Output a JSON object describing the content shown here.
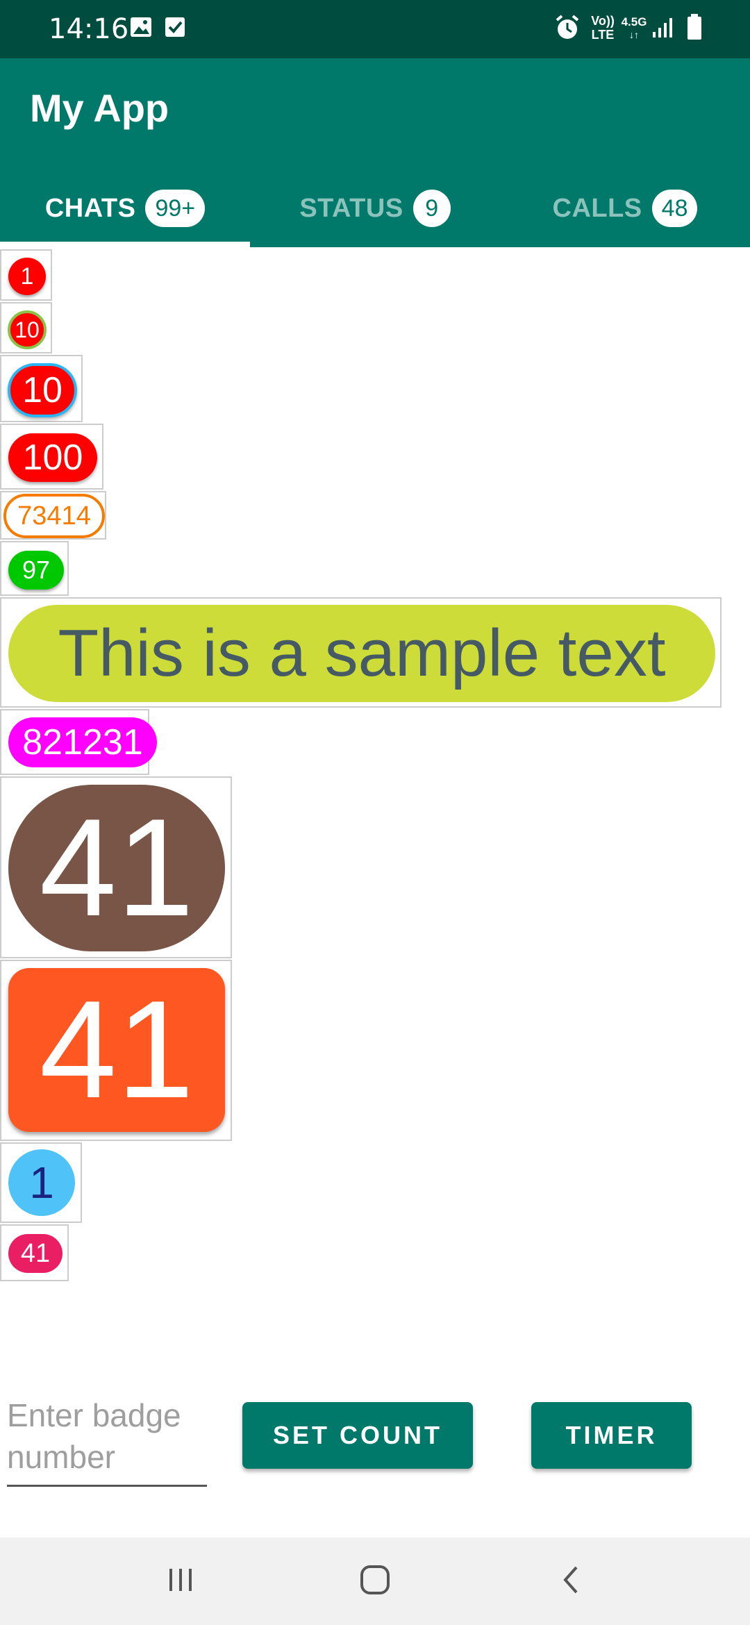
{
  "status_bar": {
    "time": "14:16",
    "icons_left": [
      "image-icon",
      "checkbox-icon"
    ],
    "icons_right": [
      "alarm-icon",
      "volte-icon",
      "network-4.5g-icon",
      "signal-icon",
      "battery-icon"
    ],
    "volte_label_top": "Vo))",
    "volte_label_bottom": "LTE",
    "network_label": "4.5G"
  },
  "app_bar": {
    "title": "My App",
    "background": "#00796b",
    "status_background": "#004d40"
  },
  "tabs": [
    {
      "label": "CHATS",
      "badge": "99+",
      "active": true
    },
    {
      "label": "STATUS",
      "badge": "9",
      "active": false
    },
    {
      "label": "CALLS",
      "badge": "48",
      "active": false
    }
  ],
  "badges": [
    {
      "text": "1",
      "background": "#ff0000",
      "border": "none",
      "color": "#ffffff"
    },
    {
      "text": "10",
      "background": "#ff0000",
      "border": "#8bc34a",
      "color": "#ffffff"
    },
    {
      "text": "10",
      "background": "#ff0000",
      "border": "#29b6f6",
      "color": "#ffffff"
    },
    {
      "text": "100",
      "background": "#ff0000",
      "border": "none",
      "color": "#ffffff"
    },
    {
      "text": "73414",
      "background": "#ffffff",
      "border": "#f57c00",
      "color": "#f57c00"
    },
    {
      "text": "97",
      "background": "#00c800",
      "border": "none",
      "color": "#ffffff"
    },
    {
      "text": "This is a sample text",
      "background": "#cddc39",
      "border": "none",
      "color": "#455a64"
    },
    {
      "text": "821231",
      "background": "#ff00ff",
      "border": "none",
      "color": "#ffffff"
    },
    {
      "text": "41",
      "background": "#795548",
      "border": "none",
      "color": "#ffffff"
    },
    {
      "text": "41",
      "background": "#ff5722",
      "border": "none",
      "color": "#ffffff"
    },
    {
      "text": "1",
      "background": "#4fc3f7",
      "border": "none",
      "color": "#1a237e"
    },
    {
      "text": "41",
      "background": "#e91e63",
      "border": "none",
      "color": "#ffffff"
    }
  ],
  "controls": {
    "input_placeholder": "Enter badge number",
    "input_value": "",
    "set_count_label": "SET COUNT",
    "timer_label": "TIMER"
  },
  "nav_bar": {
    "buttons": [
      "recents-icon",
      "home-icon",
      "back-icon"
    ]
  }
}
